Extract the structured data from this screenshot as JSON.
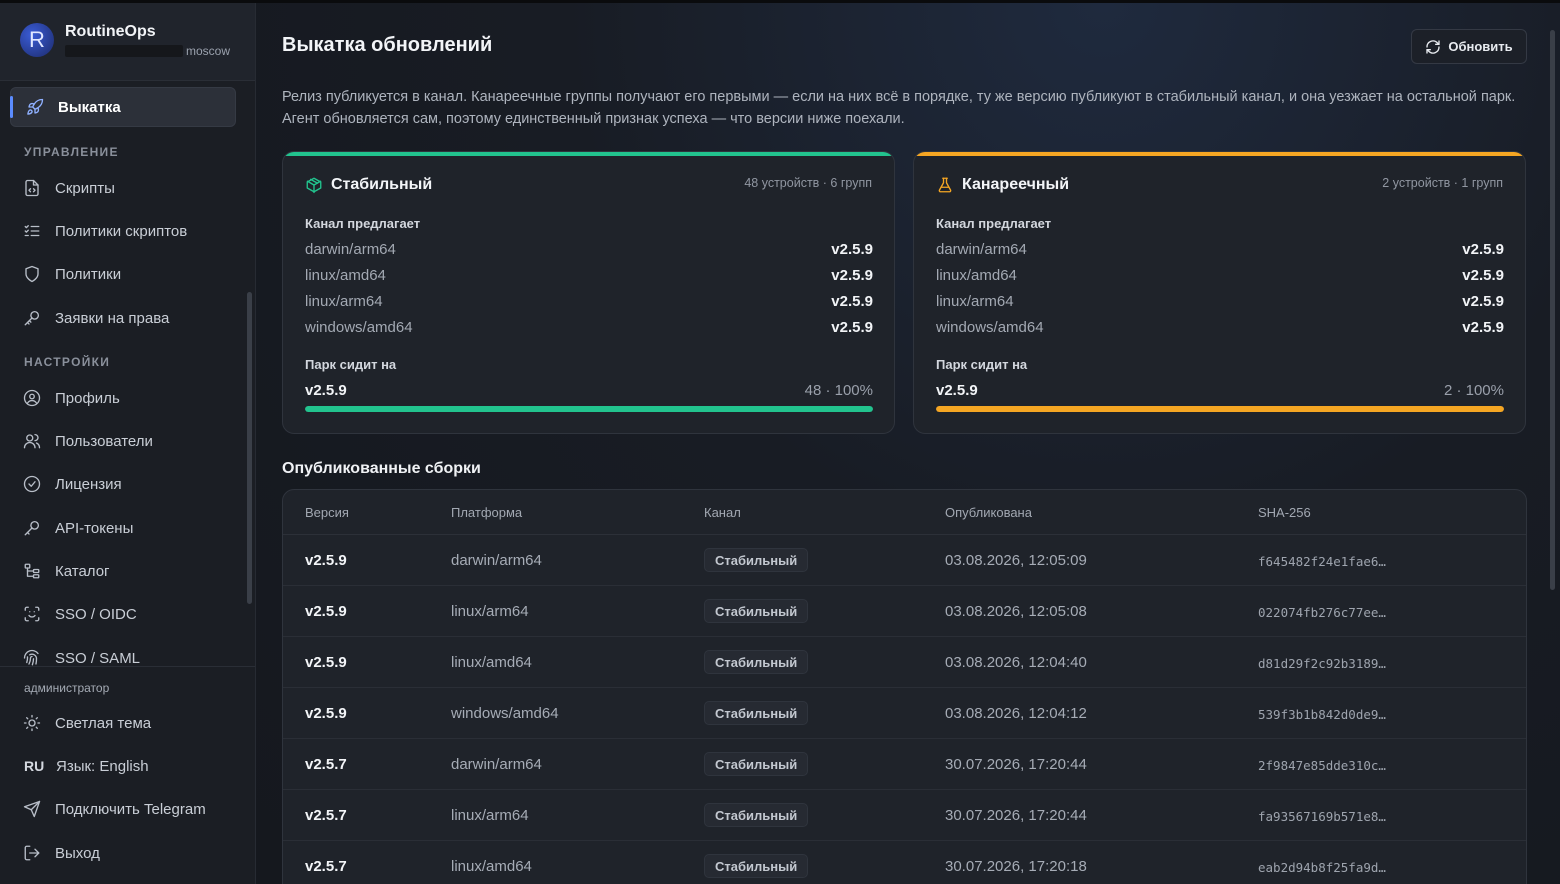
{
  "brand": {
    "name": "RoutineOps",
    "tenant": "moscow",
    "logo_letter": "R"
  },
  "sidebar": {
    "active": {
      "label": "Выкатка",
      "icon": "rocket-icon"
    },
    "sections": [
      {
        "title": "УПРАВЛЕНИЕ",
        "items": [
          {
            "label": "Скрипты",
            "icon": "script-file-icon"
          },
          {
            "label": "Политики скриптов",
            "icon": "list-check-icon"
          },
          {
            "label": "Политики",
            "icon": "shield-icon"
          },
          {
            "label": "Заявки на права",
            "icon": "key-icon"
          }
        ]
      },
      {
        "title": "НАСТРОЙКИ",
        "items": [
          {
            "label": "Профиль",
            "icon": "user-circle-icon"
          },
          {
            "label": "Пользователи",
            "icon": "users-icon"
          },
          {
            "label": "Лицензия",
            "icon": "check-circle-icon"
          },
          {
            "label": "API-токены",
            "icon": "key-icon"
          },
          {
            "label": "Каталог",
            "icon": "tree-icon"
          },
          {
            "label": "SSO / OIDC",
            "icon": "scan-face-icon"
          },
          {
            "label": "SSO / SAML",
            "icon": "fingerprint-icon"
          }
        ]
      }
    ],
    "role": "администратор",
    "bottom": {
      "theme": "Светлая тема",
      "lang_code": "RU",
      "lang": "Язык: English",
      "telegram": "Подключить Telegram",
      "logout": "Выход"
    }
  },
  "page": {
    "title": "Выкатка обновлений",
    "refresh": "Обновить",
    "intro": "Релиз публикуется в канал. Канареечные группы получают его первыми — если на них всё в порядке, ту же версию публикуют в стабильный канал, и она уезжает на остальной парк. Агент обновляется сам, поэтому единственный признак успеха — что версии ниже поехали."
  },
  "channels": [
    {
      "name": "Стабильный",
      "icon": "package-icon",
      "color": "#22c38e",
      "meta": "48 устройств · 6 групп",
      "offers_label": "Канал предлагает",
      "platforms": [
        {
          "name": "darwin/arm64",
          "version": "v2.5.9"
        },
        {
          "name": "linux/amd64",
          "version": "v2.5.9"
        },
        {
          "name": "linux/arm64",
          "version": "v2.5.9"
        },
        {
          "name": "windows/amd64",
          "version": "v2.5.9"
        }
      ],
      "park_label": "Парк сидит на",
      "park_version": "v2.5.9",
      "park_count": "48 · 100%",
      "progress": 1.0
    },
    {
      "name": "Канареечный",
      "icon": "flask-icon",
      "color": "#f5a623",
      "meta": "2 устройств · 1 групп",
      "offers_label": "Канал предлагает",
      "platforms": [
        {
          "name": "darwin/arm64",
          "version": "v2.5.9"
        },
        {
          "name": "linux/amd64",
          "version": "v2.5.9"
        },
        {
          "name": "linux/arm64",
          "version": "v2.5.9"
        },
        {
          "name": "windows/amd64",
          "version": "v2.5.9"
        }
      ],
      "park_label": "Парк сидит на",
      "park_version": "v2.5.9",
      "park_count": "2 · 100%",
      "progress": 1.0
    }
  ],
  "builds": {
    "title": "Опубликованные сборки",
    "columns": [
      "Версия",
      "Платформа",
      "Канал",
      "Опубликована",
      "SHA-256"
    ],
    "rows": [
      {
        "version": "v2.5.9",
        "platform": "darwin/arm64",
        "channel": "Стабильный",
        "published": "03.08.2026, 12:05:09",
        "sha": "f645482f24e1fae6…"
      },
      {
        "version": "v2.5.9",
        "platform": "linux/arm64",
        "channel": "Стабильный",
        "published": "03.08.2026, 12:05:08",
        "sha": "022074fb276c77ee…"
      },
      {
        "version": "v2.5.9",
        "platform": "linux/amd64",
        "channel": "Стабильный",
        "published": "03.08.2026, 12:04:40",
        "sha": "d81d29f2c92b3189…"
      },
      {
        "version": "v2.5.9",
        "platform": "windows/amd64",
        "channel": "Стабильный",
        "published": "03.08.2026, 12:04:12",
        "sha": "539f3b1b842d0de9…"
      },
      {
        "version": "v2.5.7",
        "platform": "darwin/arm64",
        "channel": "Стабильный",
        "published": "30.07.2026, 17:20:44",
        "sha": "2f9847e85dde310c…"
      },
      {
        "version": "v2.5.7",
        "platform": "linux/arm64",
        "channel": "Стабильный",
        "published": "30.07.2026, 17:20:44",
        "sha": "fa93567169b571e8…"
      },
      {
        "version": "v2.5.7",
        "platform": "linux/amd64",
        "channel": "Стабильный",
        "published": "30.07.2026, 17:20:18",
        "sha": "eab2d94b8f25fa9d…"
      }
    ]
  }
}
